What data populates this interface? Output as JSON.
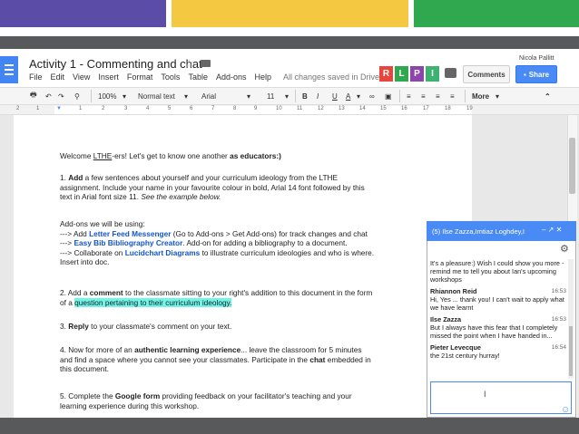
{
  "frame": {
    "bar_colors": [
      "#5b4ca8",
      "#f5c842",
      "#2fa84f"
    ],
    "dark": "#58595b"
  },
  "app": {
    "title": "Activity 1 - Commenting and chat",
    "user": "Nicola Pallitt",
    "menu": [
      "File",
      "Edit",
      "View",
      "Insert",
      "Format",
      "Tools",
      "Table",
      "Add-ons",
      "Help"
    ],
    "saved_status": "All changes saved in Drive",
    "collaborators": [
      {
        "letter": "R",
        "color": "#e8453c"
      },
      {
        "letter": "L",
        "color": "#2fa84f"
      },
      {
        "letter": "P",
        "color": "#8e44ad"
      },
      {
        "letter": "I",
        "color": "#3cb371"
      }
    ],
    "comments_label": "Comments",
    "share_label": "Share",
    "accent": "#4a8af4"
  },
  "toolbar": {
    "zoom": "100%",
    "style": "Normal text",
    "font": "Arial",
    "size": "11",
    "bold": "B",
    "italic": "I",
    "underline": "U",
    "text_color": "A",
    "more": "More"
  },
  "ruler": [
    "2",
    "1",
    "1",
    "2",
    "3",
    "4",
    "5",
    "6",
    "7",
    "8",
    "9",
    "10",
    "11",
    "12",
    "13",
    "14",
    "15",
    "16",
    "17",
    "18",
    "19"
  ],
  "doc": {
    "welcome_pre": "Welcome ",
    "welcome_lthe": "LTHE",
    "welcome_mid": "-ers! Let's get to know one another ",
    "welcome_bold": "as educators:)",
    "p1_pre": "1. ",
    "p1_add": "Add",
    "p1_l1": " a few sentences about yourself and your curriculum ideology from the LTHE",
    "p1_l2": "assignment. Include your name in your favourite colour in bold, Arial 14 font followed by this",
    "p1_l3": "text in Arial font size 11. ",
    "p1_see": "See the example below.",
    "addons_head": "Add-ons we will be using:",
    "a1_pre": "---> Add ",
    "a1_link": "Letter Feed Messenger",
    "a1_post": " (Go to Add-ons > Get Add-ons) for track changes and chat",
    "a2_pre": "---> ",
    "a2_link": "Easy Bib Bibliography Creator",
    "a2_post": ". Add-on for adding a bibliography to a document.",
    "a3_pre": "---> Collaborate on ",
    "a3_link": "Lucidchart Diagrams",
    "a3_post": " to illustrate curriculum ideologies and who is where.",
    "a3_l2": "Insert into doc.",
    "p2_pre": "2. Add a ",
    "p2_bold": "comment",
    "p2_post": " to the classmate sitting to your right's addition to this document in the form",
    "p2_l2_pre": "of a ",
    "p2_l2_hl": "question pertaining to their curriculum ideology.",
    "p3_pre": "3. ",
    "p3_bold": "Reply",
    "p3_post": " to your classmate's comment on your text.",
    "p4_pre": "4. Now for more of an ",
    "p4_bold": "authentic learning experience",
    "p4_post": "... leave the classroom for 5 minutes",
    "p4_l2_pre": "and find a space where you cannot see your classmates. Participate in the ",
    "p4_l2_bold": "chat",
    "p4_l2_post": " embedded in",
    "p4_l3": "this document.",
    "p5_pre": "5. Complete the ",
    "p5_bold": "Google form",
    "p5_post": " providing feedback on your facilitator's teaching and your",
    "p5_l2": "learning experience during this workshop."
  },
  "chat": {
    "header": "(5) Ilse Zazza,Imtiaz Loghdey,I",
    "controls": "– ↗ ✕",
    "messages": [
      {
        "name": "",
        "time": "",
        "text": "It's a pleasure:) Wish I could show you more - remind me to tell you about Ian's upcoming workshops"
      },
      {
        "name": "Rhiannon Reid",
        "time": "16:53",
        "text": "Hi, Yes ... thank you! I can't wait to apply what we have learnt"
      },
      {
        "name": "Ilse Zazza",
        "time": "16:53",
        "text": "But I always have this fear that I completely missed the point when I have handed in..."
      },
      {
        "name": "Pieter Levecque",
        "time": "16:54",
        "text": "the 21st century hurray!"
      }
    ]
  }
}
